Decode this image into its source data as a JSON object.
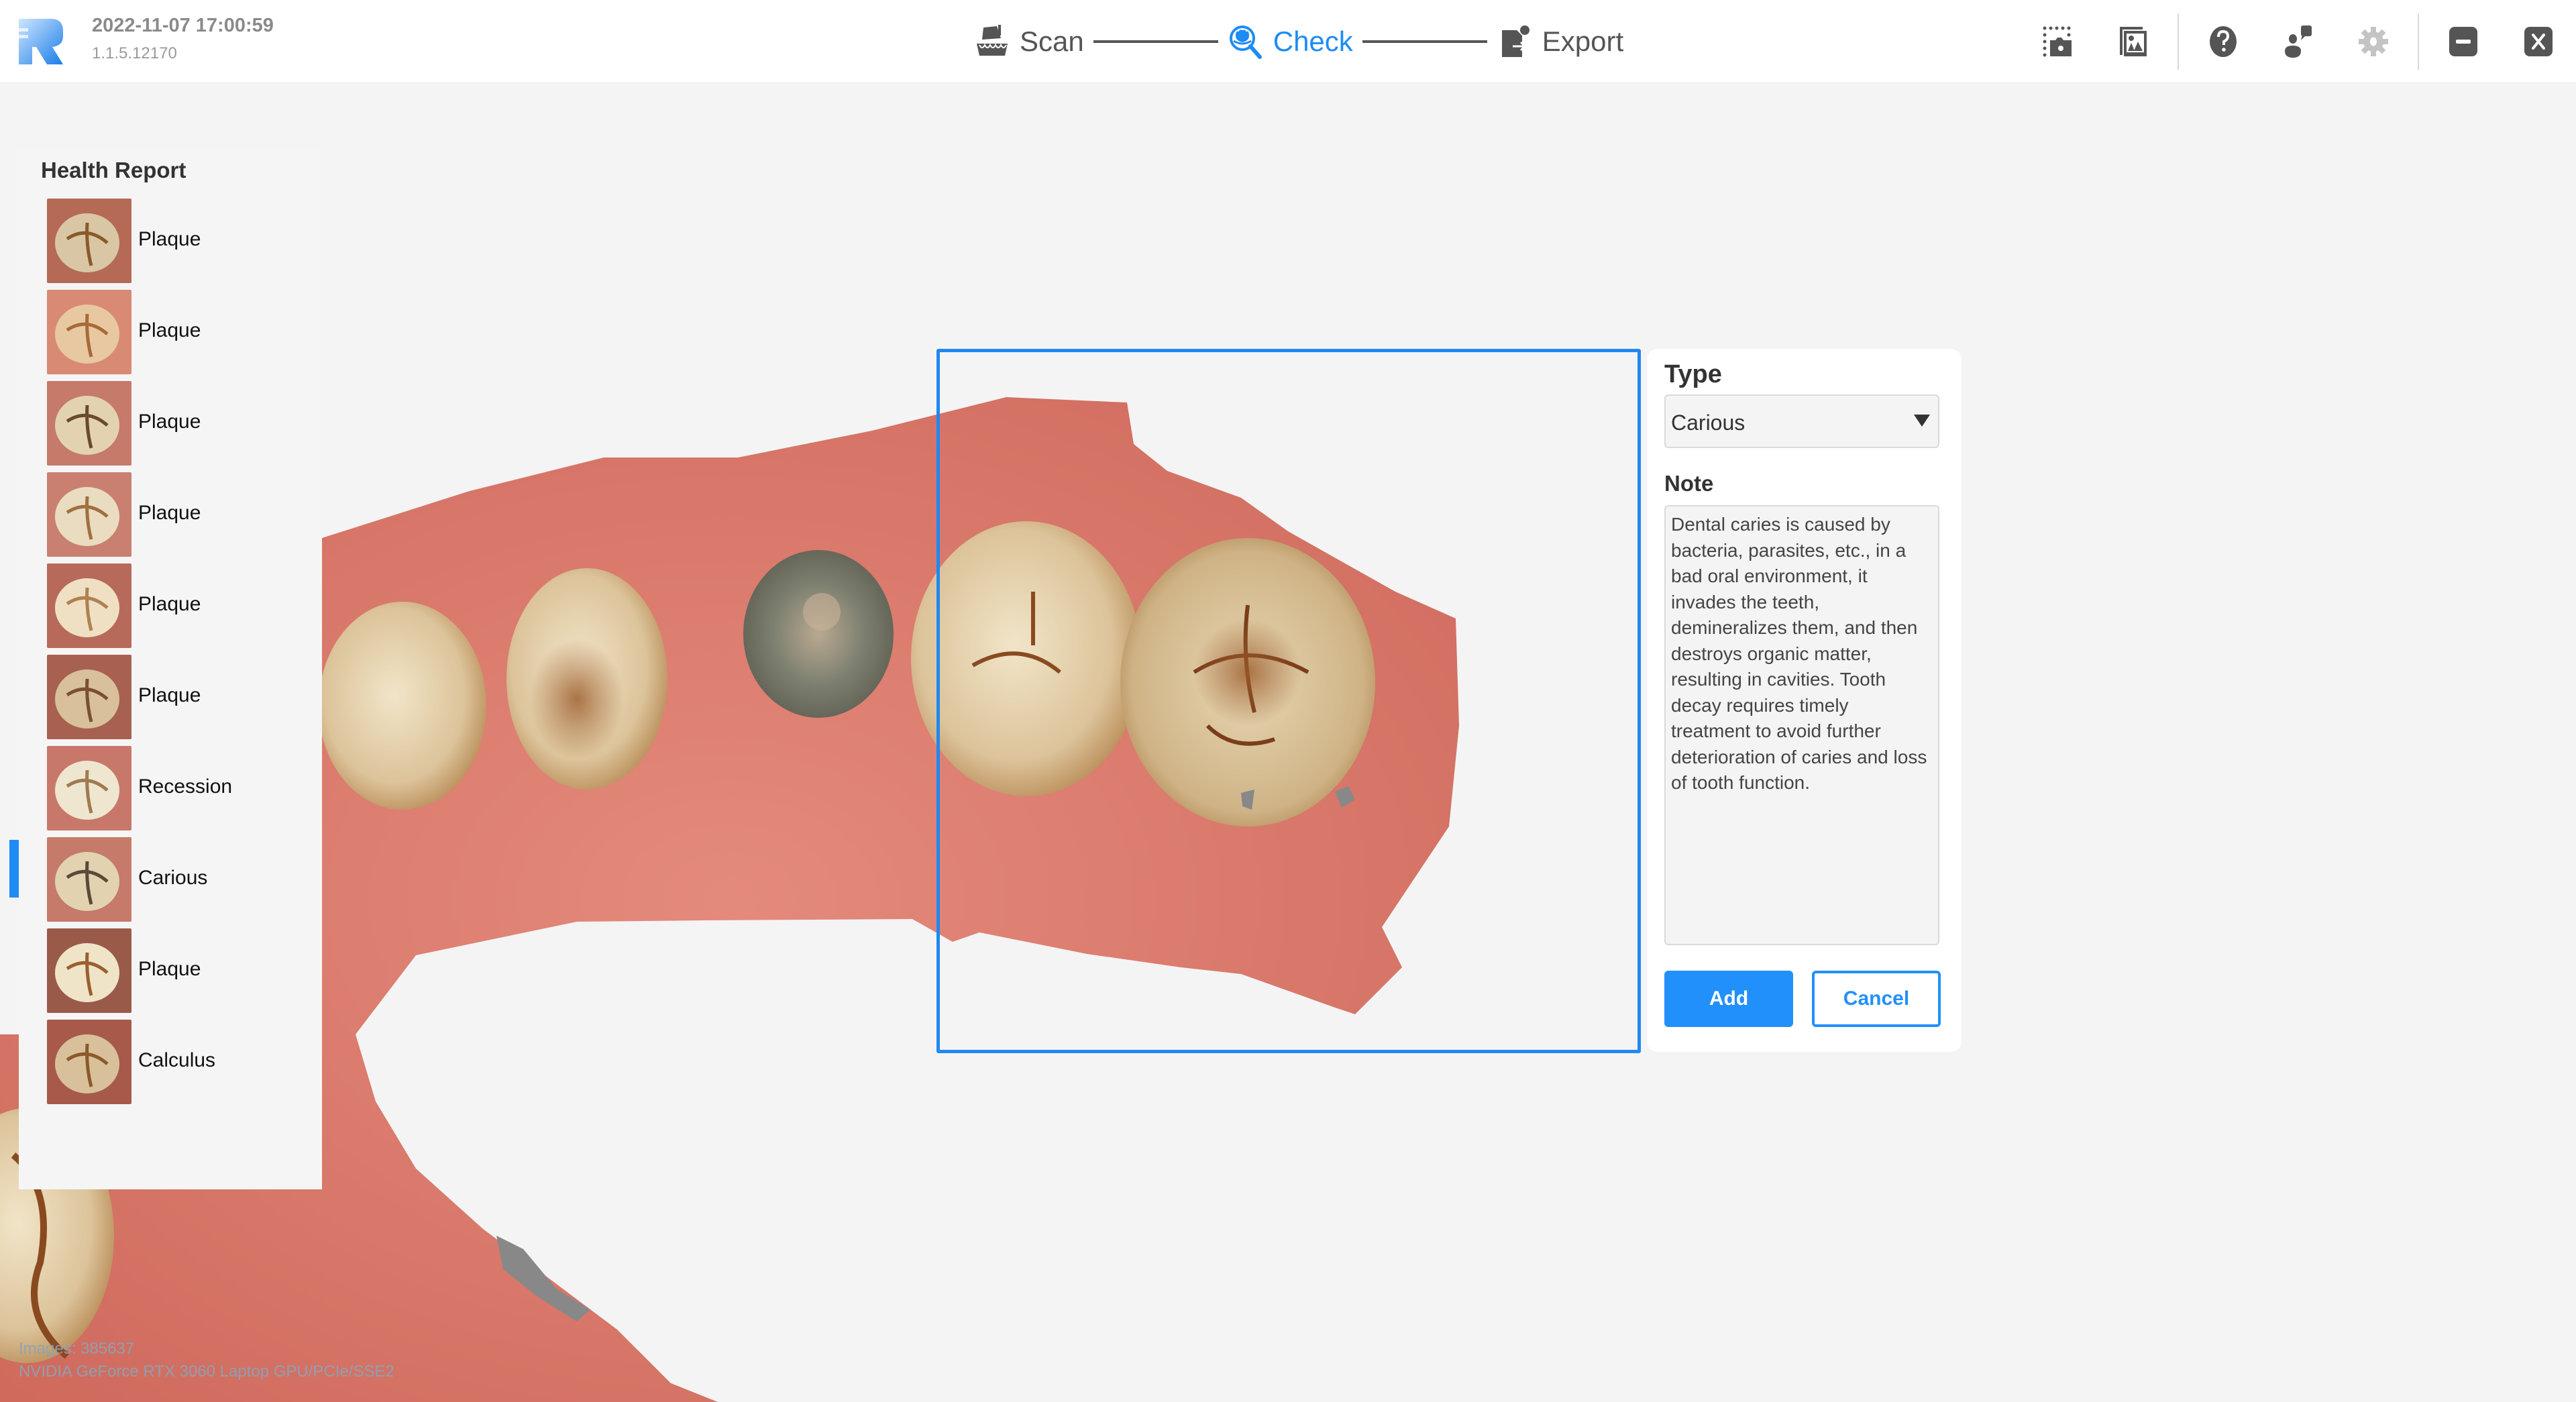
{
  "header": {
    "timestamp": "2022-11-07 17:00:59",
    "version": "1.1.5.12170",
    "steps": [
      {
        "label": "Scan",
        "icon": "scanner-icon",
        "active": false
      },
      {
        "label": "Check",
        "icon": "magnifier-teeth-icon",
        "active": true
      },
      {
        "label": "Export",
        "icon": "export-file-icon",
        "active": false
      }
    ],
    "tools": [
      {
        "name": "screenshot-area-icon"
      },
      {
        "name": "gallery-icon"
      },
      {
        "name": "help-icon"
      },
      {
        "name": "feedback-icon"
      },
      {
        "name": "settings-icon"
      },
      {
        "name": "minimize-icon"
      },
      {
        "name": "close-icon"
      }
    ],
    "accent_color": "#1e8cf5"
  },
  "sidebar": {
    "title": "Health Report",
    "selected_index": 7,
    "items": [
      {
        "label": "Plaque"
      },
      {
        "label": "Plaque"
      },
      {
        "label": "Plaque"
      },
      {
        "label": "Plaque"
      },
      {
        "label": "Plaque"
      },
      {
        "label": "Plaque"
      },
      {
        "label": "Recession"
      },
      {
        "label": "Carious"
      },
      {
        "label": "Plaque"
      },
      {
        "label": "Calculus"
      }
    ]
  },
  "form": {
    "type_label": "Type",
    "type_value": "Carious",
    "note_label": "Note",
    "note_text": "Dental caries is caused by bacteria, parasites, etc., in a bad oral environment, it invades the teeth, demineralizes them, and then destroys organic matter, resulting in cavities. Tooth decay requires timely treatment to avoid further deterioration of caries and loss of tooth function.",
    "add_label": "Add",
    "cancel_label": "Cancel"
  },
  "viewport": {
    "images_line": "Images: 385637",
    "gpu_line": "NVIDIA GeForce RTX 3060 Laptop GPU/PCIe/SSE2"
  }
}
